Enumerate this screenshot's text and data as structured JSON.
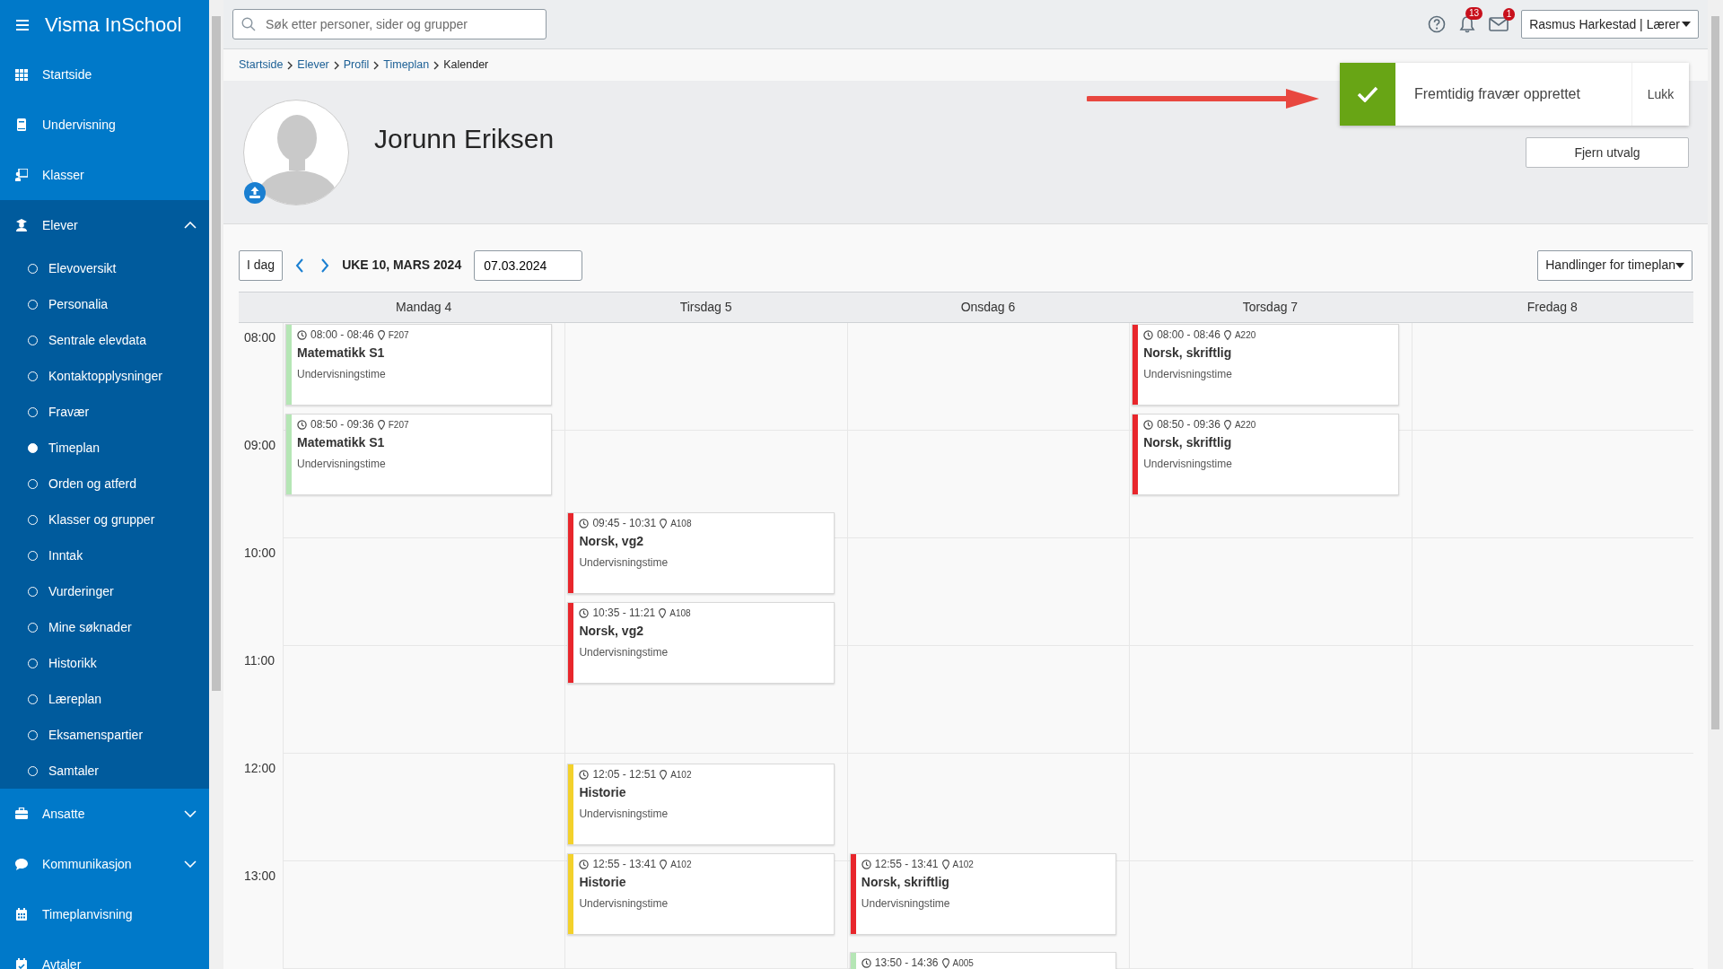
{
  "app": {
    "title": "Visma InSchool"
  },
  "sidebar": {
    "items": [
      {
        "label": "Startside"
      },
      {
        "label": "Undervisning"
      },
      {
        "label": "Klasser"
      },
      {
        "label": "Elever",
        "expanded": true,
        "children": [
          {
            "label": "Elevoversikt",
            "selected": false
          },
          {
            "label": "Personalia",
            "selected": false
          },
          {
            "label": "Sentrale elevdata",
            "selected": false
          },
          {
            "label": "Kontaktopplysninger",
            "selected": false
          },
          {
            "label": "Fravær",
            "selected": false
          },
          {
            "label": "Timeplan",
            "selected": true
          },
          {
            "label": "Orden og atferd",
            "selected": false
          },
          {
            "label": "Klasser og grupper",
            "selected": false
          },
          {
            "label": "Inntak",
            "selected": false
          },
          {
            "label": "Vurderinger",
            "selected": false
          },
          {
            "label": "Mine søknader",
            "selected": false
          },
          {
            "label": "Historikk",
            "selected": false
          },
          {
            "label": "Læreplan",
            "selected": false
          },
          {
            "label": "Eksamenspartier",
            "selected": false
          },
          {
            "label": "Samtaler",
            "selected": false
          }
        ]
      },
      {
        "label": "Ansatte",
        "expanded": false
      },
      {
        "label": "Kommunikasjon",
        "expanded": false
      },
      {
        "label": "Timeplanvisning"
      },
      {
        "label": "Avtaler"
      }
    ]
  },
  "search": {
    "placeholder": "Søk etter personer, sider og grupper"
  },
  "header": {
    "notifications": "13",
    "messages": "1",
    "user": "Rasmus Harkestad | Lærer"
  },
  "breadcrumb": [
    {
      "label": "Startside",
      "current": false
    },
    {
      "label": "Elever",
      "current": false
    },
    {
      "label": "Profil",
      "current": false
    },
    {
      "label": "Timeplan",
      "current": false
    },
    {
      "label": "Kalender",
      "current": true
    }
  ],
  "profile": {
    "name": "Jorunn Eriksen"
  },
  "toast": {
    "message": "Fremtidig fravær opprettet",
    "close": "Lukk"
  },
  "clear_button": "Fjern utvalg",
  "calendar": {
    "today": "I dag",
    "week": "UKE 10, MARS 2024",
    "date": "07.03.2024",
    "actions": "Handlinger for timeplan",
    "hours": [
      "08:00",
      "09:00",
      "10:00",
      "11:00",
      "12:00",
      "13:00"
    ],
    "days": [
      {
        "label": "Mandag 4",
        "events": [
          {
            "time": "08:00 - 08:46",
            "room": "F207",
            "title": "Matematikk S1",
            "type": "Undervisningstime",
            "color": "#b5e6b5"
          },
          {
            "time": "08:50 - 09:36",
            "room": "F207",
            "title": "Matematikk S1",
            "type": "Undervisningstime",
            "color": "#b5e6b5"
          }
        ]
      },
      {
        "label": "Tirsdag 5",
        "events": [
          {
            "time": "09:45 - 10:31",
            "room": "A108",
            "title": "Norsk, vg2",
            "type": "Undervisningstime",
            "color": "#e8262c"
          },
          {
            "time": "10:35 - 11:21",
            "room": "A108",
            "title": "Norsk, vg2",
            "type": "Undervisningstime",
            "color": "#e8262c"
          },
          {
            "time": "12:05 - 12:51",
            "room": "A102",
            "title": "Historie",
            "type": "Undervisningstime",
            "color": "#f3d12b"
          },
          {
            "time": "12:55 - 13:41",
            "room": "A102",
            "title": "Historie",
            "type": "Undervisningstime",
            "color": "#f3d12b"
          }
        ]
      },
      {
        "label": "Onsdag 6",
        "events": [
          {
            "time": "12:55 - 13:41",
            "room": "A102",
            "title": "Norsk, skriftlig",
            "type": "Undervisningstime",
            "color": "#e8262c"
          },
          {
            "time": "13:50 - 14:36",
            "room": "A005",
            "color": "#b5e6b5"
          }
        ]
      },
      {
        "label": "Torsdag 7",
        "events": [
          {
            "time": "08:00 - 08:46",
            "room": "A220",
            "title": "Norsk, skriftlig",
            "type": "Undervisningstime",
            "color": "#e8262c"
          },
          {
            "time": "08:50 - 09:36",
            "room": "A220",
            "title": "Norsk, skriftlig",
            "type": "Undervisningstime",
            "color": "#e8262c"
          }
        ]
      },
      {
        "label": "Fredag 8"
      }
    ]
  }
}
